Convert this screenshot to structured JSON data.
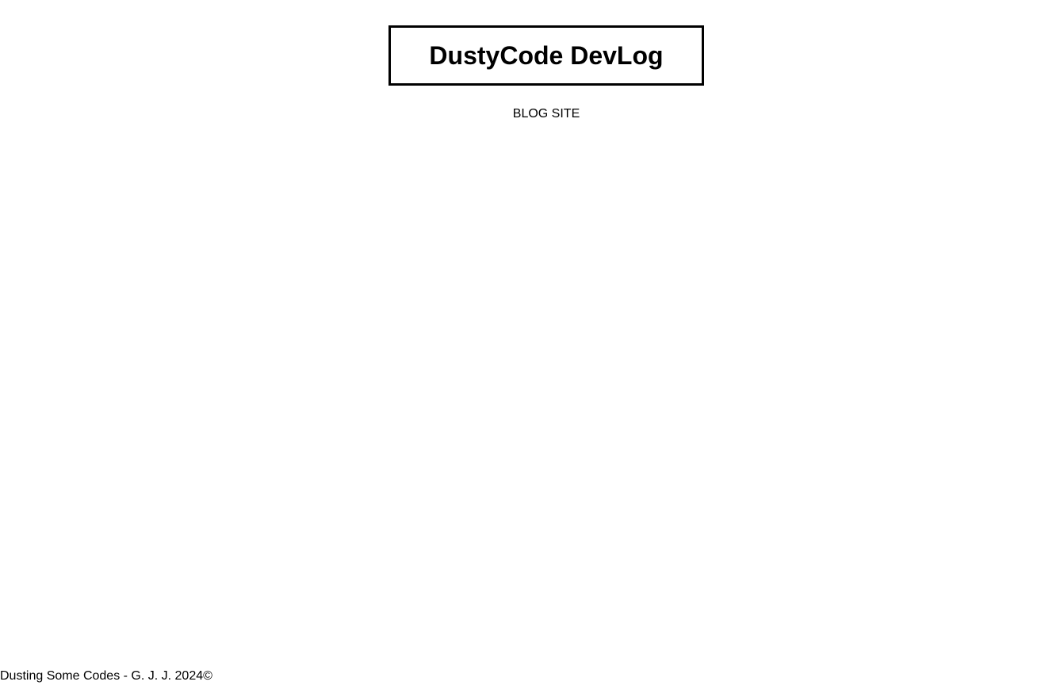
{
  "header": {
    "title": "DustyCode DevLog",
    "subtitle": "BLOG SITE"
  },
  "footer": {
    "text": "Dusting Some Codes - G. J. J. 2024©"
  },
  "colors": {
    "background": "#ffffff",
    "text": "#000000",
    "border": "#000000"
  }
}
